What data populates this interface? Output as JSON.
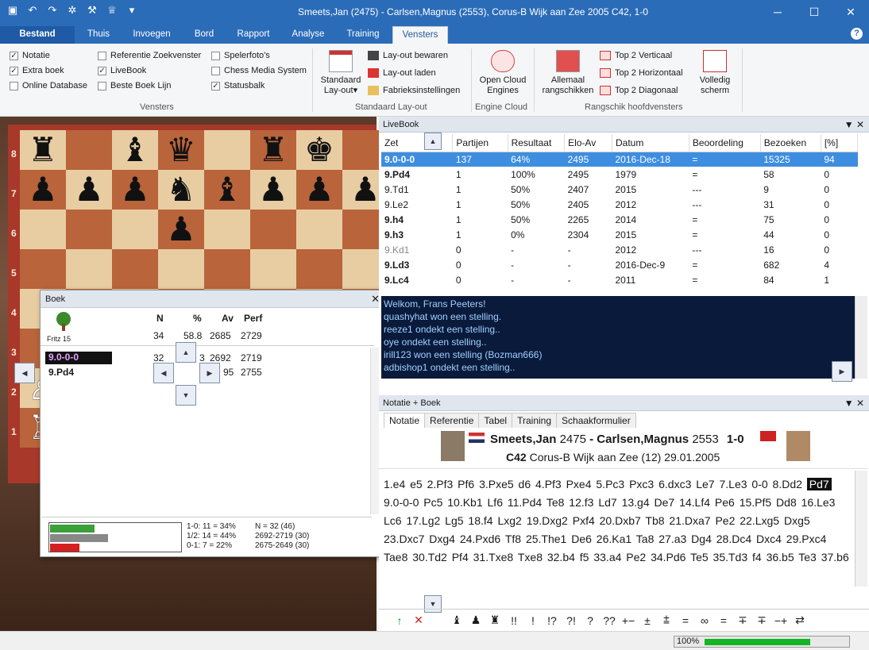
{
  "window": {
    "title": "Smeets,Jan (2475) - Carlsen,Magnus (2553), Corus-B Wijk aan Zee 2005  C42, 1-0"
  },
  "ribbon_tabs": [
    "Bestand",
    "Thuis",
    "Invoegen",
    "Bord",
    "Rapport",
    "Analyse",
    "Training",
    "Vensters"
  ],
  "ribbon": {
    "checks": [
      {
        "label": "Notatie",
        "checked": true
      },
      {
        "label": "Extra boek",
        "checked": true
      },
      {
        "label": "Online Database",
        "checked": false
      },
      {
        "label": "Referentie Zoekvenster",
        "checked": false
      },
      {
        "label": "LiveBook",
        "checked": true
      },
      {
        "label": "Beste Boek Lijn",
        "checked": false
      },
      {
        "label": "Spelerfoto's",
        "checked": false
      },
      {
        "label": "Chess Media System",
        "checked": false
      },
      {
        "label": "Statusbalk",
        "checked": true
      }
    ],
    "group_vensters": "Vensters",
    "standaard_layout_label": "Standaard Lay-out▾",
    "layout_save": "Lay-out bewaren",
    "layout_load": "Lay-out laden",
    "factory": "Fabrieksinstellingen",
    "group_layout": "Standaard Lay-out",
    "open_cloud": "Open Cloud Engines",
    "group_engine": "Engine Cloud",
    "allemaal": "Allemaal rangschikken",
    "top2v": "Top 2 Verticaal",
    "top2h": "Top 2 Horizontaal",
    "top2d": "Top 2 Diagonaal",
    "group_rang": "Rangschik hoofdvensters",
    "volledig": "Volledig scherm"
  },
  "board": {
    "ranks": [
      "8",
      "7",
      "6",
      "5",
      "4",
      "3",
      "2",
      "1"
    ],
    "position": [
      [
        "r",
        "",
        "b",
        "q",
        "",
        "r",
        "k",
        ""
      ],
      [
        "p",
        "p",
        "p",
        "n",
        "b",
        "p",
        "p",
        "p"
      ],
      [
        "",
        "",
        "",
        "p",
        "",
        "",
        "",
        ""
      ],
      [
        "",
        "",
        "",
        "",
        "",
        "",
        "",
        ""
      ],
      [
        "",
        "",
        "",
        "",
        "",
        "",
        "",
        ""
      ],
      [
        "",
        "",
        "",
        "",
        "",
        "",
        "",
        ""
      ],
      [
        "P",
        "",
        "",
        "",
        "",
        "",
        "",
        ""
      ],
      [
        "R",
        "",
        "",
        "",
        "",
        "",
        "",
        ""
      ]
    ]
  },
  "book": {
    "title": "Boek",
    "columns": [
      "N",
      "%",
      "Av",
      "Perf"
    ],
    "engine_label": "Fritz 15",
    "total": {
      "n": "34",
      "pct": "58.8",
      "av": "2685",
      "perf": "2729"
    },
    "rows": [
      {
        "move": "9.0-0-0",
        "n": "32",
        "pct": "3",
        "av": "2692",
        "perf": "2719"
      },
      {
        "move": "9.Pd4",
        "n": "",
        "pct": "95",
        "av": "",
        "perf": "2755"
      }
    ],
    "stats": {
      "bar_white": 0.34,
      "bar_draw": 0.44,
      "bar_black": 0.22,
      "line1": "1-0: 11 = 34%",
      "line2": "1/2: 14 = 44%",
      "line3": "0-1: 7 = 22%",
      "n_total": "N = 32 (46)",
      "range1": "2692-2719 (30)",
      "range2": "2675-2649 (30)"
    }
  },
  "livebook": {
    "title": "LiveBook",
    "headers": [
      "Zet",
      "Partijen",
      "Resultaat",
      "Elo-Av",
      "Datum",
      "Beoordeling",
      "Bezoeken",
      "[%]"
    ],
    "rows": [
      [
        "9.0-0-0",
        "137",
        "64%",
        "2495",
        "2016-Dec-18",
        "=",
        "15325",
        "94"
      ],
      [
        "9.Pd4",
        "1",
        "100%",
        "2495",
        "1979",
        "=",
        "58",
        "0"
      ],
      [
        "9.Td1",
        "1",
        "50%",
        "2407",
        "2015",
        "---",
        "9",
        "0"
      ],
      [
        "9.Le2",
        "1",
        "50%",
        "2405",
        "2012",
        "---",
        "31",
        "0"
      ],
      [
        "9.h4",
        "1",
        "50%",
        "2265",
        "2014",
        "=",
        "75",
        "0"
      ],
      [
        "9.h3",
        "1",
        "0%",
        "2304",
        "2015",
        "=",
        "44",
        "0"
      ],
      [
        "9.Kd1",
        "0",
        "-",
        "-",
        "2012",
        "---",
        "16",
        "0"
      ],
      [
        "9.Ld3",
        "0",
        "-",
        "-",
        "2016-Dec-9",
        "=",
        "682",
        "4"
      ],
      [
        "9.Lc4",
        "0",
        "-",
        "-",
        "2011",
        "=",
        "84",
        "1"
      ]
    ]
  },
  "chat": [
    "Welkom, Frans Peeters!",
    "quashyhat won een stelling.",
    "reeze1 ondekt een stelling..",
    "oye ondekt een stelling..",
    "irill123 won een stelling (Bozman666)",
    "adbishop1 ondekt een stelling.."
  ],
  "notation": {
    "title": "Notatie + Boek",
    "tabs": [
      "Notatie",
      "Referentie",
      "Tabel",
      "Training",
      "Schaakformulier"
    ],
    "white": "Smeets,Jan",
    "white_elo": "2475",
    "black": "Carlsen,Magnus",
    "black_elo": "2553",
    "result": "1-0",
    "eco": "C42",
    "event": "Corus-B Wijk aan Zee (12) 29.01.2005",
    "moves_before": "1.e4  e5  2.Pf3  Pf6  3.Pxe5  d6  4.Pf3  Pxe4  5.Pc3  Pxc3  6.dxc3  Le7  7.Le3  0-0  8.Dd2 ",
    "current": "Pd7",
    "moves_after": "  9.0-0-0  Pc5  10.Kb1  Lf6  11.Pd4  Te8  12.f3  Ld7  13.g4  De7  14.Lf4  Pe6  15.Pf5  Dd8  16.Le3  Lc6  17.Lg2  Lg5  18.f4  Lxg2  19.Dxg2  Pxf4  20.Dxb7  Tb8  21.Dxa7  Pe2  22.Lxg5  Dxg5  23.Dxc7  Dxg4  24.Pxd6  Tf8  25.The1  De6  26.Ka1  Ta8  27.a3  Dg4  28.Dc4  Dxc4  29.Pxc4  Tae8  30.Td2  Pf4  31.Txe8  Txe8  32.b4  f5  33.a4  Pe2  34.Pd6  Te5  35.Td3  f4  36.b5  Te3  37.b6"
  },
  "symbols": [
    "↑",
    "✕",
    "",
    "♝",
    "♟",
    "♜",
    "!!",
    "!",
    "!?",
    "?!",
    "?",
    "??",
    "+−",
    "±",
    "⩲",
    "=",
    "∞",
    "=",
    "∓",
    "∓",
    "−+",
    "⇄"
  ],
  "status": {
    "zoom": "100%",
    "progress": 0.6
  }
}
